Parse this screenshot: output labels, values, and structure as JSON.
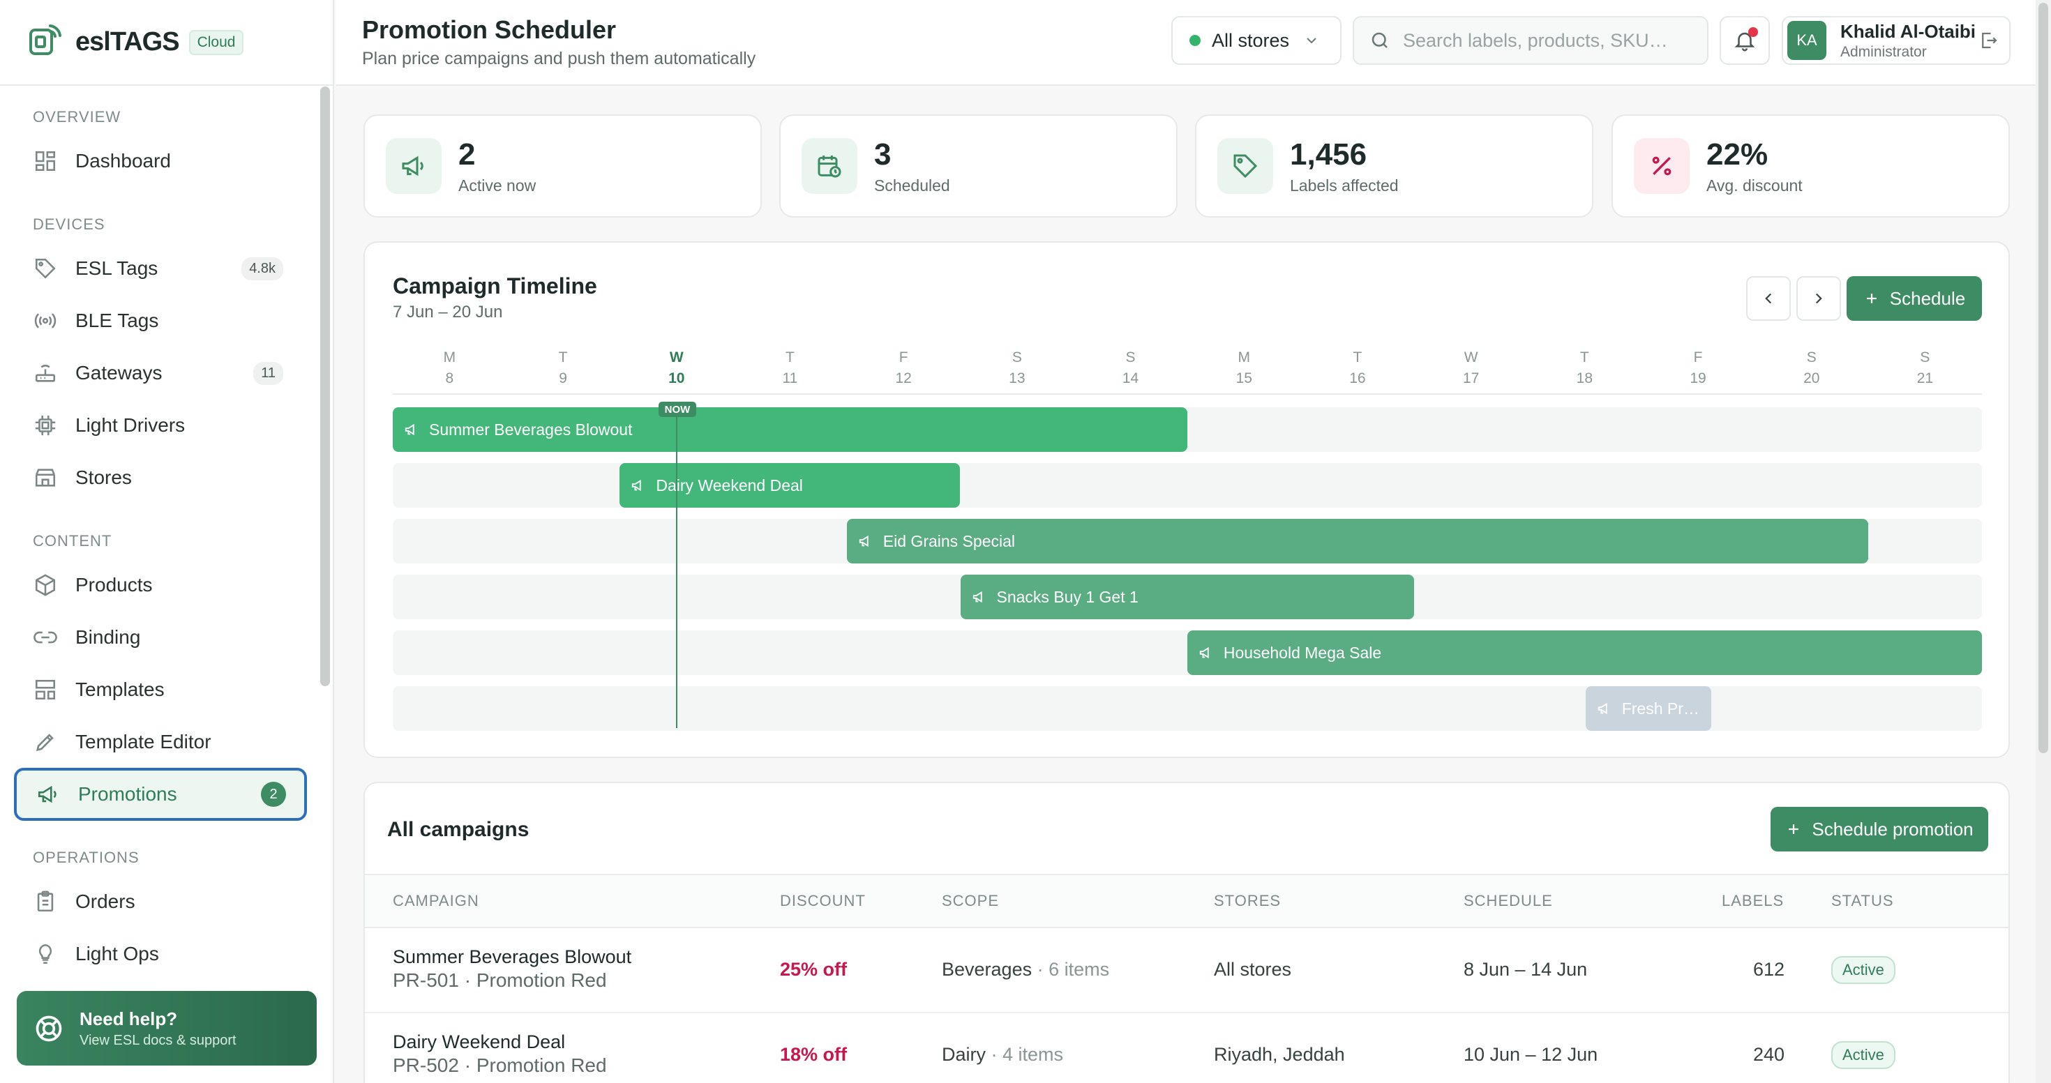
{
  "brand": {
    "name": "eslTAGS",
    "badge": "Cloud"
  },
  "sidebar": {
    "sections": [
      "Overview",
      "Devices",
      "Content",
      "Operations"
    ],
    "items": [
      {
        "label": "Dashboard",
        "icon": "dashboard-icon"
      },
      {
        "label": "ESL Tags",
        "icon": "tag-icon",
        "count": "4.8k"
      },
      {
        "label": "BLE Tags",
        "icon": "ble-icon"
      },
      {
        "label": "Gateways",
        "icon": "router-icon",
        "count": "11"
      },
      {
        "label": "Light Drivers",
        "icon": "chip-icon"
      },
      {
        "label": "Stores",
        "icon": "store-icon"
      },
      {
        "label": "Products",
        "icon": "box-icon"
      },
      {
        "label": "Binding",
        "icon": "link-icon"
      },
      {
        "label": "Templates",
        "icon": "layout-icon"
      },
      {
        "label": "Template Editor",
        "icon": "pen-icon"
      },
      {
        "label": "Promotions",
        "icon": "megaphone-icon",
        "count": "2",
        "active": true
      },
      {
        "label": "Orders",
        "icon": "clipboard-icon"
      },
      {
        "label": "Light Ops",
        "icon": "bulb-icon"
      }
    ],
    "help": {
      "title": "Need help?",
      "subtitle": "View ESL docs & support"
    }
  },
  "header": {
    "title": "Promotion Scheduler",
    "subtitle": "Plan price campaigns and push them automatically",
    "store_select": "All stores",
    "search_placeholder": "Search labels, products, SKU…",
    "user": {
      "initials": "KA",
      "name": "Khalid Al-Otaibi",
      "role": "Administrator"
    }
  },
  "stats": [
    {
      "value": "2",
      "label": "Active now",
      "icon": "megaphone-icon",
      "color": "#3d8c63",
      "bg": "#eaf5ef"
    },
    {
      "value": "3",
      "label": "Scheduled",
      "icon": "calendar-clock-icon",
      "color": "#3d8c63",
      "bg": "#eaf5ef"
    },
    {
      "value": "1,456",
      "label": "Labels affected",
      "icon": "tag-icon",
      "color": "#3d8c63",
      "bg": "#eaf5ef"
    },
    {
      "value": "22%",
      "label": "Avg. discount",
      "icon": "percent-icon",
      "color": "#c8174d",
      "bg": "#fdebf0"
    }
  ],
  "timeline": {
    "title": "Campaign Timeline",
    "range": "7 Jun – 20 Jun",
    "schedule_label": "Schedule",
    "now_label": "NOW",
    "days": [
      {
        "d": "M",
        "n": "8"
      },
      {
        "d": "T",
        "n": "9"
      },
      {
        "d": "W",
        "n": "10",
        "current": true
      },
      {
        "d": "T",
        "n": "11"
      },
      {
        "d": "F",
        "n": "12"
      },
      {
        "d": "S",
        "n": "13"
      },
      {
        "d": "S",
        "n": "14"
      },
      {
        "d": "M",
        "n": "15"
      },
      {
        "d": "T",
        "n": "16"
      },
      {
        "d": "W",
        "n": "17"
      },
      {
        "d": "T",
        "n": "18"
      },
      {
        "d": "F",
        "n": "19"
      },
      {
        "d": "S",
        "n": "20"
      },
      {
        "d": "S",
        "n": "21"
      }
    ],
    "bars": [
      {
        "label": "Summer Beverages Blowout",
        "start_day": "8",
        "end_day": "14",
        "color": "#43b77a"
      },
      {
        "label": "Dairy Weekend Deal",
        "start_day": "10",
        "end_day": "12",
        "color": "#43b77a"
      },
      {
        "label": "Eid Grains Special",
        "start_day": "12",
        "end_day": "20",
        "color": "#5aac83"
      },
      {
        "label": "Snacks Buy 1 Get 1",
        "start_day": "13",
        "end_day": "16",
        "color": "#5aac83"
      },
      {
        "label": "Household Mega Sale",
        "start_day": "15",
        "end_day": "21",
        "color": "#5aac83"
      },
      {
        "label": "Fresh Pr…",
        "start_day": "19",
        "end_day": "19",
        "color": "#c9d4dc"
      }
    ]
  },
  "campaigns": {
    "title": "All campaigns",
    "button": "Schedule promotion",
    "columns": [
      "Campaign",
      "Discount",
      "Scope",
      "Stores",
      "Schedule",
      "Labels",
      "Status"
    ],
    "rows": [
      {
        "name": "Summer Beverages Blowout",
        "code": "PR-501 · Promotion Red",
        "discount": "25% off",
        "scope": "Beverages",
        "items": "· 6 items",
        "stores": "All stores",
        "schedule": "8 Jun – 14 Jun",
        "labels": "612",
        "status": "Active"
      },
      {
        "name": "Dairy Weekend Deal",
        "code": "PR-502 · Promotion Red",
        "discount": "18% off",
        "scope": "Dairy",
        "items": "· 4 items",
        "stores": "Riyadh, Jeddah",
        "schedule": "10 Jun – 12 Jun",
        "labels": "240",
        "status": "Active"
      }
    ]
  }
}
